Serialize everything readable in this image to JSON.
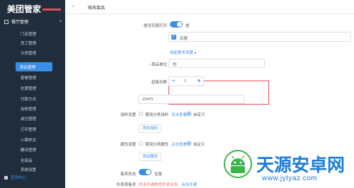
{
  "brand": {
    "name": "美团管家"
  },
  "sidebar": {
    "section": "餐厅管理",
    "items": [
      {
        "label": "门店管理"
      },
      {
        "label": "员工管理"
      },
      {
        "label": "分类管理"
      },
      {
        "label": "菜品管理"
      },
      {
        "label": "套餐管理"
      },
      {
        "label": "优惠管理"
      },
      {
        "label": "付款方式"
      },
      {
        "label": "挂帐管理"
      },
      {
        "label": "桌位管理"
      },
      {
        "label": "打印管理"
      },
      {
        "label": "小票样式"
      },
      {
        "label": "翻译管理"
      },
      {
        "label": "全部品"
      },
      {
        "label": "系统设置"
      }
    ],
    "bottom": {
      "label": "营销中心"
    }
  },
  "topbar": {
    "title": "修改菜品"
  },
  "form": {
    "print_label": "是否后厨打印",
    "print_toggle_text": "是",
    "print_checkbox_label": "后厨",
    "more_settings_link": "收起更多设置 ▴",
    "unit_label": "菜品单位",
    "unit_value": "份",
    "portion_label": "起售份数",
    "portion_value": "1",
    "minus_symbol": "−",
    "plus_symbol": "+",
    "code_label": "菜品编码",
    "code_value": "23475",
    "ingredient_label": "加料设置",
    "ingredient_option_1": "使用分类加料",
    "ingredient_view_link": "点击查看",
    "ingredient_option_2": "自定义",
    "add_ingredient_button": "添加加料",
    "attribute_label": "属性设置",
    "attribute_option_1": "使用分类属性",
    "attribute_view_link": "点击查看",
    "attribute_option_2": "自定义",
    "add_attribute_button": "添加属性",
    "status_label": "售卖状态",
    "status_toggle_text": "在售",
    "takeout_label": "外卖菜售卖",
    "takeout_text": "尚未开通美团外卖业务，",
    "takeout_link": "点击开通"
  },
  "watermark": {
    "title": "天源安卓网",
    "url": "www.jytyaz.com"
  },
  "colors": {
    "sidebar_bg": "#1f2d3d",
    "accent": "#3a8ee6",
    "highlight": "#e84a5f"
  }
}
